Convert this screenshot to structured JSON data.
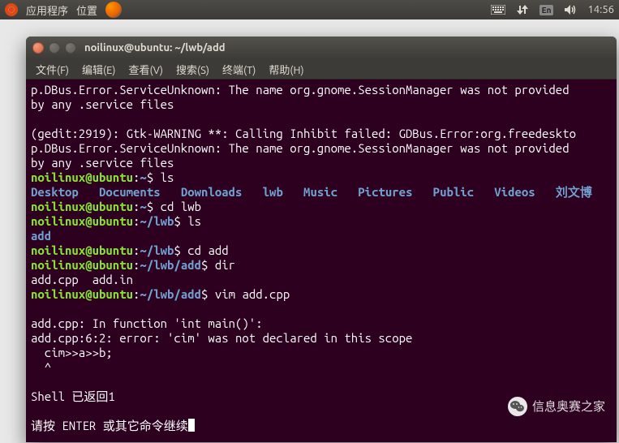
{
  "panel": {
    "apps": "应用程序",
    "places": "位置",
    "ime": "En",
    "clock": "14:56"
  },
  "window": {
    "title": "noilinux@ubuntu: ~/lwb/add"
  },
  "menu": {
    "file": "文件(F)",
    "edit": "编辑(E)",
    "view": "查看(V)",
    "search": "搜索(S)",
    "terminal": "终端(T)",
    "help": "帮助(H)"
  },
  "term": {
    "l1": "p.DBus.Error.ServiceUnknown: The name org.gnome.SessionManager was not provided",
    "l2": "by any .service files",
    "l3": "",
    "l4": "(gedit:2919): Gtk-WARNING **: Calling Inhibit failed: GDBus.Error:org.freedeskto",
    "l5": "p.DBus.Error.ServiceUnknown: The name org.gnome.SessionManager was not provided",
    "l6": "by any .service files",
    "p1_user": "noilinux@ubuntu",
    "p1_path": "~",
    "p1_cmd": "ls",
    "dirs": {
      "desktop": "Desktop",
      "documents": "Documents",
      "downloads": "Downloads",
      "lwb": "lwb",
      "music": "Music",
      "pictures": "Pictures",
      "public": "Public",
      "videos": "Videos",
      "cjk": "刘文博"
    },
    "p2_cmd": "cd lwb",
    "p3_path": "~/lwb",
    "p3_cmd": "ls",
    "ls2": "add",
    "p4_cmd": "cd add",
    "p5_path": "~/lwb/add",
    "p5_cmd": "dir",
    "dirout": "add.cpp  add.in",
    "p6_cmd": "vim add.cpp",
    "err1": "add.cpp: In function 'int main()':",
    "err2": "add.cpp:6:2: error: 'cim' was not declared in this scope",
    "err3": "  cim>>a>>b;",
    "err4": "  ^",
    "shell_ret": "Shell 已返回1",
    "press_enter": "请按 ENTER 或其它命令继续"
  },
  "watermark": "信息奥赛之家"
}
